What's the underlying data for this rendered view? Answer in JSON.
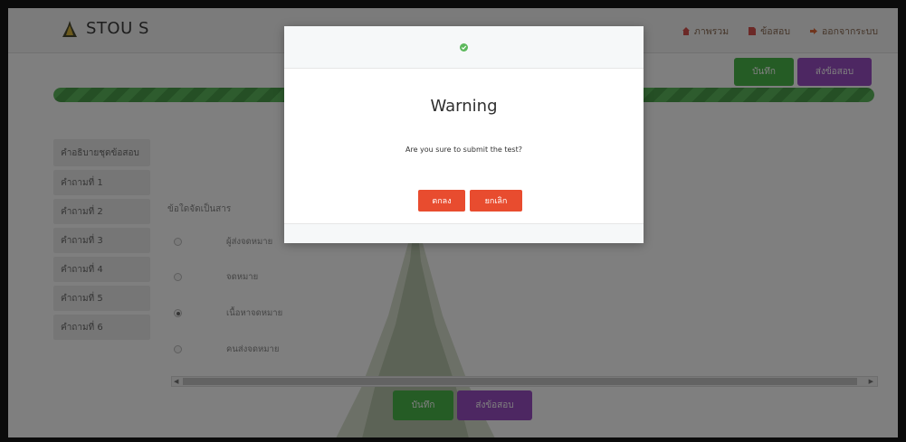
{
  "brand": {
    "name": "STOU S"
  },
  "nav": {
    "links": [
      {
        "label": "ภาพรวม",
        "color": "#d9534f"
      },
      {
        "label": "ข้อสอบ",
        "color": "#d9534f"
      },
      {
        "label": "ออกจากระบบ",
        "color": "#e06b3b"
      }
    ]
  },
  "actions": {
    "save": "บันทึก",
    "submit": "ส่งข้อสอบ"
  },
  "progress": {
    "fraction": 1.0
  },
  "sidebar": {
    "items": [
      {
        "label": "คำอธิบายชุดข้อสอบ"
      },
      {
        "label": "คำถามที่ 1"
      },
      {
        "label": "คำถามที่ 2"
      },
      {
        "label": "คำถามที่ 3"
      },
      {
        "label": "คำถามที่ 4"
      },
      {
        "label": "คำถามที่ 5"
      },
      {
        "label": "คำถามที่ 6"
      }
    ]
  },
  "question": {
    "title": "ข้อใดจัดเป็นสาร",
    "choices": [
      {
        "label": "ผู้ส่งจดหมาย",
        "checked": false
      },
      {
        "label": "จดหมาย",
        "checked": false
      },
      {
        "label": "เนื้อหาจดหมาย",
        "checked": true
      },
      {
        "label": "คนส่งจดหมาย",
        "checked": false
      }
    ]
  },
  "modal": {
    "title": "Warning",
    "message": "Are you sure to submit the test?",
    "ok": "ตกลง",
    "cancel": "ยกเลิก"
  },
  "colors": {
    "green": "#4bb84b",
    "purple": "#9b4fc4",
    "red": "#e84c2f"
  }
}
